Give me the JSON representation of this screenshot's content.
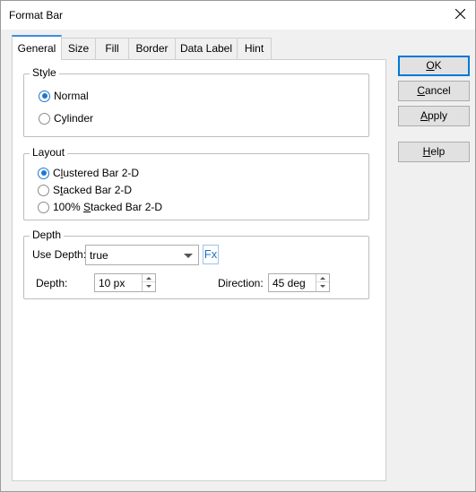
{
  "window": {
    "title": "Format Bar"
  },
  "tabs": [
    {
      "label": "General",
      "active": true
    },
    {
      "label": "Size"
    },
    {
      "label": "Fill"
    },
    {
      "label": "Border"
    },
    {
      "label": "Data Label"
    },
    {
      "label": "Hint"
    }
  ],
  "style_group": {
    "title": "Style",
    "options": [
      {
        "label": "Normal",
        "checked": true
      },
      {
        "label": "Cylinder",
        "checked": false
      }
    ]
  },
  "layout_group": {
    "title": "Layout",
    "options": [
      {
        "label_pre": "C",
        "mnemonic": "l",
        "label_post": "ustered Bar 2-D",
        "checked": true
      },
      {
        "label_pre": "S",
        "mnemonic": "t",
        "label_post": "acked Bar 2-D",
        "checked": false
      },
      {
        "label_pre": "100% ",
        "mnemonic": "S",
        "label_post": "tacked Bar 2-D",
        "checked": false
      }
    ]
  },
  "depth_group": {
    "title": "Depth",
    "use_depth_label": "Use Depth:",
    "use_depth_value": "true",
    "fx_label": "Fx",
    "depth_label": "Depth:",
    "depth_value": "10 px",
    "direction_label": "Direction:",
    "direction_value": "45 deg"
  },
  "buttons": {
    "ok": {
      "mnemonic": "O",
      "rest": "K"
    },
    "cancel": {
      "mnemonic": "C",
      "rest": "ancel"
    },
    "apply": {
      "mnemonic": "A",
      "rest": "pply"
    },
    "help": {
      "mnemonic": "H",
      "rest": "elp"
    }
  },
  "colors": {
    "accent": "#1e78d2",
    "window_bg": "#f0f0f0",
    "panel_bg": "#ffffff"
  }
}
